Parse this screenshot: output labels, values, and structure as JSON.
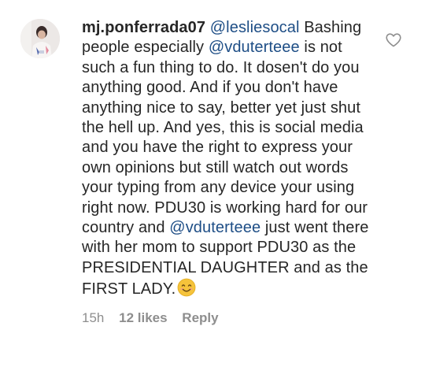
{
  "comment": {
    "username": "mj.ponferrada07",
    "mention_1": "@lesliesocal",
    "text_1": "Bashing people especially",
    "mention_2": "@vduterteee",
    "text_2": "is not such a fun thing to do. It dosen't do you anything good. And if you don't have anything nice to say, better yet just shut the hell up. And yes, this is social media and you have the right to express your own opinions but still watch out words your typing from any device your using right now. PDU30 is working hard for our country and",
    "mention_3": "@vduterteee",
    "text_3": "just went there with her mom to support PDU30 as the PRESIDENTIAL DAUGHTER and as the FIRST LADY.",
    "emoji": "smiling-face-emoji",
    "timestamp": "15h",
    "likes": "12 likes",
    "reply_label": "Reply"
  },
  "icons": {
    "like": "heart-outline-icon"
  },
  "colors": {
    "text": "#262626",
    "mention": "#1e4e86",
    "meta": "#8e8e8e",
    "heart": "#8e8e8e",
    "emoji": "#f5c33b"
  }
}
